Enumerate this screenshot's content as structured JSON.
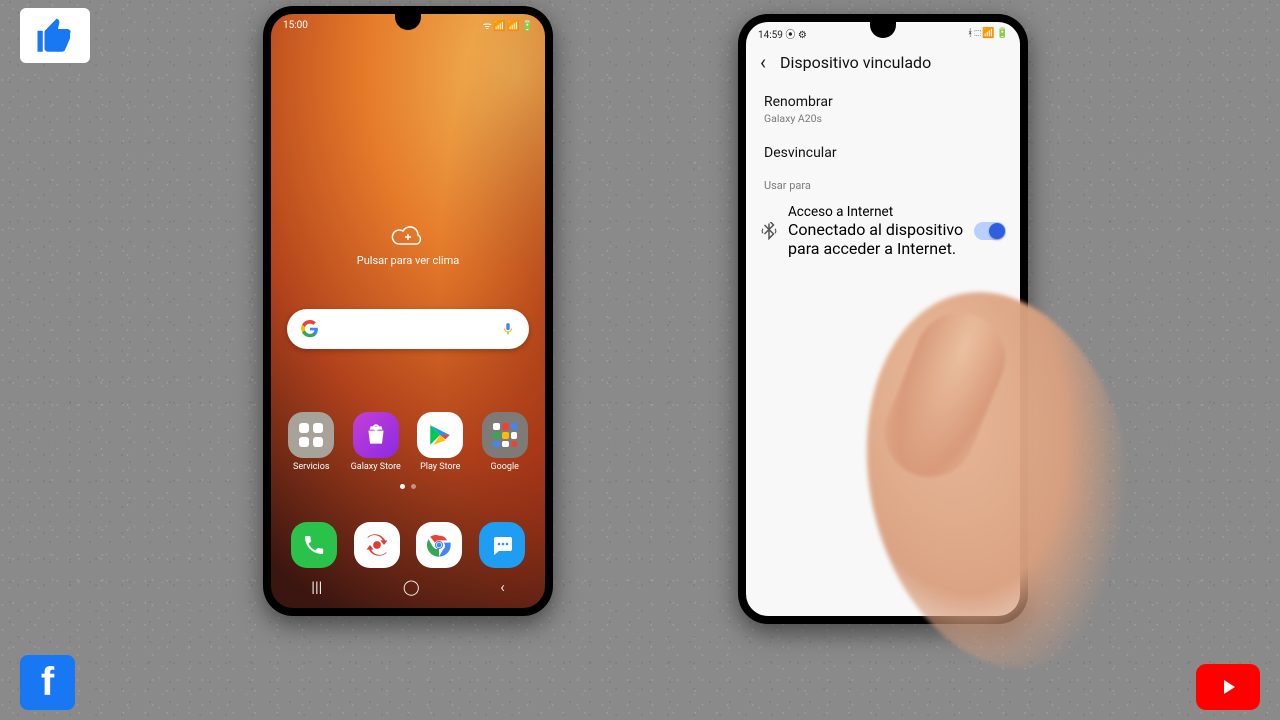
{
  "overlay": {
    "thumbs_up_name": "thumbs-up-icon",
    "facebook_letter": "f",
    "youtube_name": "youtube-icon"
  },
  "left_phone": {
    "status": {
      "time": "15:00",
      "left_icons": "✿ ⊙ ⚙",
      "right_icons": "ᯤ 📶 📶 🔋"
    },
    "weather": {
      "label": "Pulsar para ver clima",
      "plus": "+"
    },
    "search": {
      "placeholder": ""
    },
    "apps": [
      {
        "label": "Servicios"
      },
      {
        "label": "Galaxy Store"
      },
      {
        "label": "Play Store"
      },
      {
        "label": "Google"
      }
    ],
    "dock": [
      {
        "name": "phone-icon"
      },
      {
        "name": "camera-switch-icon"
      },
      {
        "name": "chrome-icon"
      },
      {
        "name": "messages-icon"
      }
    ],
    "nav": {
      "recents": "|||",
      "home": "◯",
      "back": "‹"
    }
  },
  "right_phone": {
    "status": {
      "time": "14:59",
      "left_icons": "⦿ ⚙",
      "right_icons": "ᚼ ⬚ 📶 🔋"
    },
    "header": {
      "title": "Dispositivo vinculado",
      "back": "‹"
    },
    "items": {
      "rename": {
        "primary": "Renombrar",
        "secondary": "Galaxy A20s"
      },
      "unpair": {
        "primary": "Desvincular"
      }
    },
    "section_label": "Usar para",
    "internet_row": {
      "title": "Acceso a Internet",
      "subtitle": "Conectado al dispositivo para acceder a Internet.",
      "toggle_on": true
    }
  }
}
